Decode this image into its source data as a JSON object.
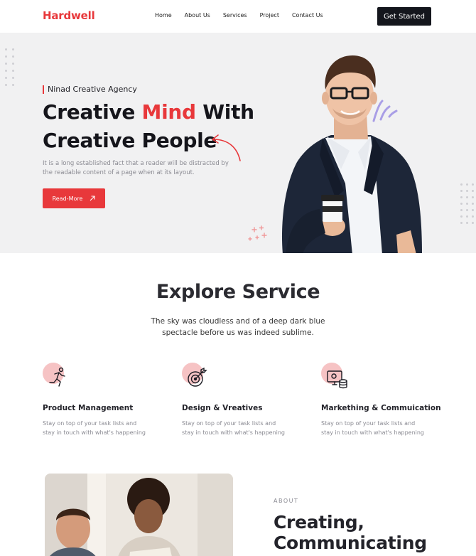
{
  "nav": {
    "logo": "Hardwell",
    "links": [
      "Home",
      "About Us",
      "Services",
      "Project",
      "Contact Us"
    ],
    "cta": "Get Started"
  },
  "hero": {
    "tagline": "Ninad Creative Agency",
    "headline_part1": "Creative ",
    "headline_accent": "Mind",
    "headline_part2": " With",
    "headline_line2": "Creative People",
    "description": "It is a long established fact that a reader will be distracted by the readable content of a page when at its layout.",
    "button": "Read-More",
    "button_icon": "arrow-up-right-icon"
  },
  "services": {
    "title": "Explore Service",
    "subtitle": "The sky was cloudless and of a deep dark blue spectacle before us was indeed sublime.",
    "cards": [
      {
        "title": "Product Management",
        "text": "Stay on top of your task lists and stay in touch with what's happening",
        "icon": "running-person-icon"
      },
      {
        "title": "Design & Vreatives",
        "text": "Stay on top of your task lists and stay in touch with what's happening",
        "icon": "target-icon"
      },
      {
        "title": "Markething & Commuication",
        "text": "Stay on top of your task lists and stay in touch with what's happening",
        "icon": "monitor-database-icon"
      }
    ]
  },
  "about": {
    "label": "ABOUT",
    "heading_line1": "Creating,",
    "heading_line2": "Communicating"
  },
  "colors": {
    "accent": "#e8383b",
    "dark": "#14161d",
    "hero_bg": "#f1f1f2",
    "blob": "#f6c3c4",
    "squiggle": "#a99ee6"
  }
}
